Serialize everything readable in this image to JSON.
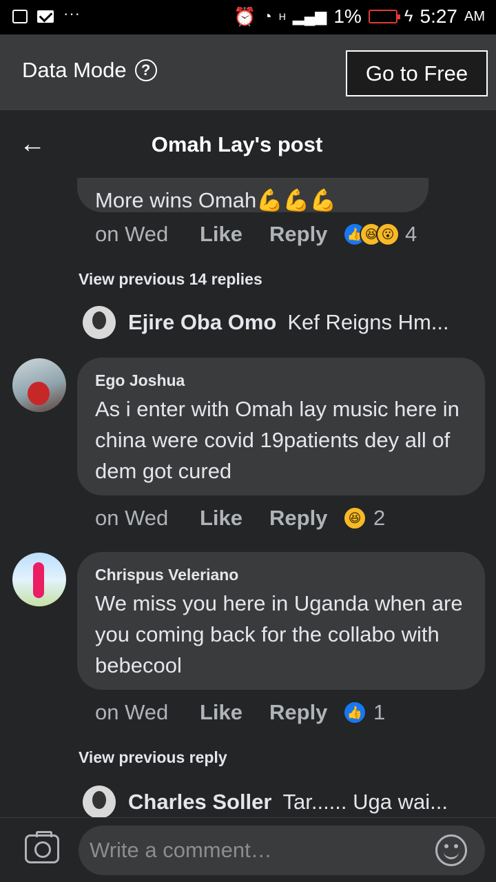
{
  "status_bar": {
    "battery": "1%",
    "time": "5:27",
    "ampm": "AM",
    "network": "H"
  },
  "data_mode": {
    "label": "Data Mode",
    "help_icon": "?",
    "go_free_label": "Go to Free"
  },
  "header": {
    "back_icon": "🡐",
    "title": "Omah Lay's post"
  },
  "top_comment": {
    "text": "More wins  Omah",
    "emoji": "💪💪💪",
    "time": "on Wed",
    "like": "Like",
    "reply": "Reply",
    "reaction_count": "4"
  },
  "view_previous_1": "View previous 14 replies",
  "reply_preview_1": {
    "name": "Ejire Oba Omo",
    "text": "Kef Reigns Hm..."
  },
  "comments": [
    {
      "name": "Ego Joshua",
      "text": "As i enter with Omah lay music here in china were covid 19patients dey all of dem got cured",
      "time": "on Wed",
      "like": "Like",
      "reply": "Reply",
      "reaction_count": "2"
    },
    {
      "name": "Chrispus Veleriano",
      "text": "We miss you here in Uganda when are you coming back for the collabo with bebecool",
      "time": "on Wed",
      "like": "Like",
      "reply": "Reply",
      "reaction_count": "1"
    }
  ],
  "view_previous_2": "View previous reply",
  "reply_preview_2": {
    "name": "Charles Soller",
    "text": "Tar...... Uga wai..."
  },
  "composer": {
    "placeholder": "Write a comment…"
  },
  "icons": {
    "like": "👍",
    "haha": "😆",
    "wow": "😮"
  }
}
